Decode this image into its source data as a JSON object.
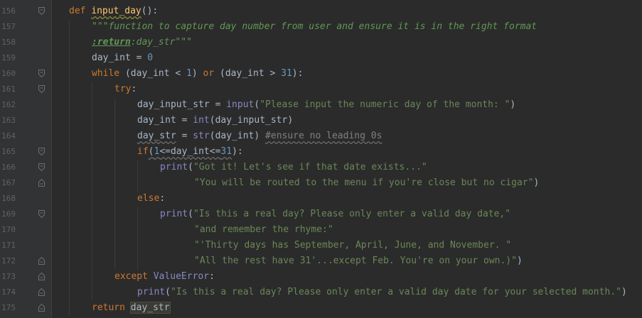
{
  "gutter": {
    "line_numbers": [
      "156",
      "157",
      "158",
      "159",
      "160",
      "161",
      "162",
      "163",
      "164",
      "165",
      "166",
      "167",
      "168",
      "169",
      "170",
      "171",
      "172",
      "173",
      "174",
      "175"
    ]
  },
  "code": {
    "l156": {
      "kw": "def",
      "fn": "input_day",
      "rest": "():"
    },
    "l157": {
      "doc": "\"\"\"function to capture day number from user and ensure it is in the right format"
    },
    "l158": {
      "tag": ":return",
      "doc": ":day_str\"\"\""
    },
    "l159": {
      "a": "day_int = ",
      "num": "0"
    },
    "l160": {
      "kw": "while",
      "a": " (day_int < ",
      "n1": "1",
      "b": ") ",
      "kw2": "or",
      "c": " (day_int > ",
      "n2": "31",
      "d": "):"
    },
    "l161": {
      "kw": "try",
      "a": ":"
    },
    "l162": {
      "a": "day_input_str = ",
      "bi": "input",
      "b": "(",
      "str": "\"Please input the numeric day of the month: \"",
      "c": ")"
    },
    "l163": {
      "a": "day_int = ",
      "bi": "int",
      "b": "(day_input_str)"
    },
    "l164": {
      "a": "day_str",
      "b": " = ",
      "bi": "str",
      "c": "(day_int) ",
      "cmt": "#ensure no leading 0s"
    },
    "l165": {
      "kw": "if",
      "a": "(",
      "n1": "1",
      "b": "<=day_int<=",
      "n2": "31",
      "c": "):"
    },
    "l166": {
      "bi": "print",
      "a": "(",
      "str": "\"Got it! Let's see if that date exists...\""
    },
    "l167": {
      "str": "\"You will be routed to the menu if you're close but no cigar\"",
      "a": ")"
    },
    "l168": {
      "kw": "else",
      "a": ":"
    },
    "l169": {
      "bi": "print",
      "a": "(",
      "str": "\"Is this a real day? Please only enter a valid day date,\""
    },
    "l170": {
      "str": "\"and remember the rhyme:\""
    },
    "l171": {
      "str": "\"'Thirty days has September, April, June, and November. \""
    },
    "l172": {
      "str": "\"All the rest have 31'...except Feb. You're on your own.)\"",
      "a": ")"
    },
    "l173": {
      "kw": "except",
      "a": " ",
      "bi": "ValueError",
      "b": ":"
    },
    "l174": {
      "bi": "print",
      "a": "(",
      "str": "\"Is this a real day? Please only enter a valid day date for your selected month.\"",
      "b": ")"
    },
    "l175": {
      "kw": "return",
      "a": " ",
      "hl": "day_str"
    }
  },
  "colors": {
    "background": "#2b2b2b",
    "gutter": "#313335",
    "keyword": "#cc7832",
    "function": "#ffc66d",
    "string": "#6a8759",
    "number": "#6897bb",
    "builtin": "#8888c6",
    "comment": "#808080",
    "text": "#a9b7c6"
  },
  "icons": [
    "fold-open-icon",
    "fold-close-icon"
  ]
}
